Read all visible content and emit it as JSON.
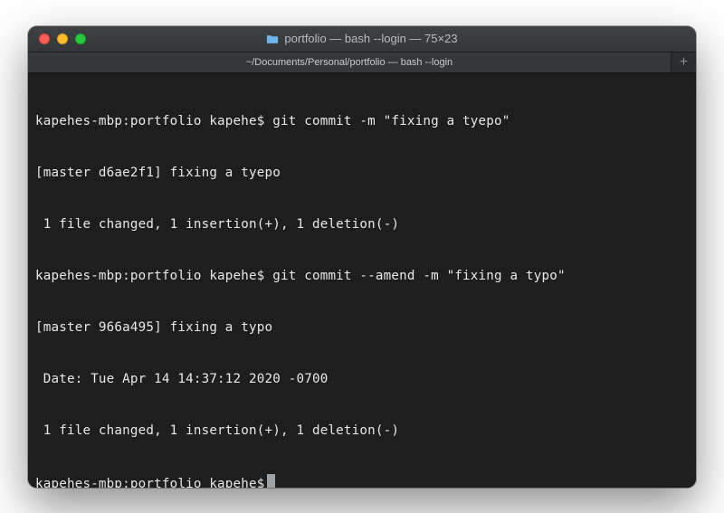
{
  "window": {
    "title": "portfolio — bash --login — 75×23"
  },
  "tabs": {
    "active_label": "~/Documents/Personal/portfolio — bash --login",
    "add_label": "+"
  },
  "terminal": {
    "lines": [
      "kapehes-mbp:portfolio kapehe$ git commit -m \"fixing a tyepo\"",
      "[master d6ae2f1] fixing a tyepo",
      " 1 file changed, 1 insertion(+), 1 deletion(-)",
      "kapehes-mbp:portfolio kapehe$ git commit --amend -m \"fixing a typo\"",
      "[master 966a495] fixing a typo",
      " Date: Tue Apr 14 14:37:12 2020 -0700",
      " 1 file changed, 1 insertion(+), 1 deletion(-)"
    ],
    "prompt": "kapehes-mbp:portfolio kapehe$"
  },
  "colors": {
    "bg": "#1e1e1e",
    "text": "#e8e8e8",
    "titlebar_text": "#b8bcbf"
  }
}
